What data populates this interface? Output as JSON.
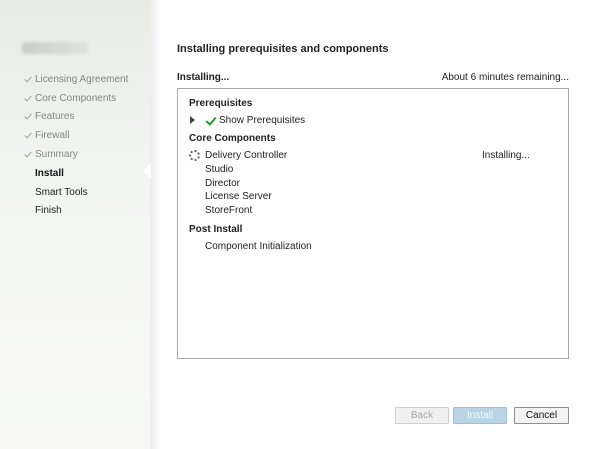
{
  "sidebar": {
    "steps": [
      {
        "label": "Licensing Agreement",
        "state": "done"
      },
      {
        "label": "Core Components",
        "state": "done"
      },
      {
        "label": "Features",
        "state": "done"
      },
      {
        "label": "Firewall",
        "state": "done"
      },
      {
        "label": "Summary",
        "state": "done"
      },
      {
        "label": "Install",
        "state": "active"
      },
      {
        "label": "Smart Tools",
        "state": "pending"
      },
      {
        "label": "Finish",
        "state": "pending"
      }
    ]
  },
  "main": {
    "title": "Installing prerequisites and components",
    "status": "Installing...",
    "remaining": "About 6 minutes remaining...",
    "sections": {
      "prerequisites": {
        "heading": "Prerequisites",
        "show_label": "Show Prerequisites"
      },
      "core": {
        "heading": "Core Components",
        "items": [
          {
            "label": "Delivery Controller",
            "state": "Installing..."
          },
          {
            "label": "Studio"
          },
          {
            "label": "Director"
          },
          {
            "label": "License Server"
          },
          {
            "label": "StoreFront"
          }
        ]
      },
      "post": {
        "heading": "Post Install",
        "items": [
          {
            "label": "Component Initialization"
          }
        ]
      }
    }
  },
  "buttons": {
    "back": "Back",
    "install": "Install",
    "cancel": "Cancel"
  },
  "colors": {
    "check_green": "#2a9a2a",
    "install_button": "#b9d5e5"
  },
  "icons": {
    "done_step": "checkmark-icon",
    "expand": "expand-triangle-icon",
    "prereq_done": "green-check-icon",
    "in_progress": "spinner-icon"
  }
}
